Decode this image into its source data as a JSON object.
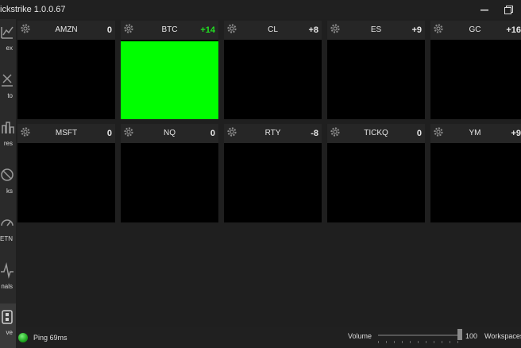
{
  "app": {
    "title": "ickstrike 1.0.0.67"
  },
  "window": {
    "minimize_icon": "minimize-icon",
    "maximize_icon": "restore-icon"
  },
  "sidebar": {
    "items": [
      {
        "label": "ex",
        "icon": "chart-icon"
      },
      {
        "label": "to",
        "icon": "tools-icon"
      },
      {
        "label": "res",
        "icon": "futures-icon"
      },
      {
        "label": "ks",
        "icon": "stocks-icon"
      },
      {
        "label": "ETN",
        "icon": "etn-icon"
      },
      {
        "label": "nals",
        "icon": "signals-icon"
      },
      {
        "label": "ve",
        "icon": "save-icon",
        "active": true
      }
    ]
  },
  "tiles": [
    {
      "symbol": "AMZN",
      "value": "0"
    },
    {
      "symbol": "BTC",
      "value": "+14",
      "positive": true,
      "highlight": "#00ff00"
    },
    {
      "symbol": "CL",
      "value": "+8"
    },
    {
      "symbol": "ES",
      "value": "+9"
    },
    {
      "symbol": "GC",
      "value": "+16"
    },
    {
      "symbol": "MSFT",
      "value": "0"
    },
    {
      "symbol": "NQ",
      "value": "0"
    },
    {
      "symbol": "RTY",
      "value": "-8"
    },
    {
      "symbol": "TICKQ",
      "value": "0"
    },
    {
      "symbol": "YM",
      "value": "+9"
    }
  ],
  "status": {
    "ping": "Ping 69ms",
    "volume_label": "Volume",
    "volume_value": "100",
    "workspaces_label": "Workspaces"
  },
  "colors": {
    "accent_green": "#22e022",
    "tile_highlight": "#00ff00"
  }
}
